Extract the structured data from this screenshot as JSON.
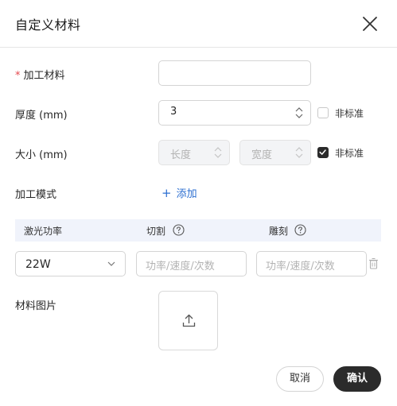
{
  "dialog": {
    "title": "自定义材料",
    "close_icon": "close-icon"
  },
  "form": {
    "material": {
      "required_mark": "*",
      "label": "加工材料",
      "value": ""
    },
    "thickness": {
      "label": "厚度 (mm)",
      "value": "3",
      "nonstandard_label": "非标准",
      "nonstandard_checked": false
    },
    "size": {
      "label": "大小 (mm)",
      "length_placeholder": "长度",
      "width_placeholder": "宽度",
      "nonstandard_label": "非标准",
      "nonstandard_checked": true
    },
    "mode": {
      "label": "加工模式",
      "add_label": "添加"
    }
  },
  "table": {
    "headers": [
      "激光功率",
      "切割",
      "雕刻"
    ],
    "rows": [
      {
        "power": "22W",
        "cut_placeholder": "功率/速度/次数",
        "engrave_placeholder": "功率/速度/次数"
      }
    ]
  },
  "image": {
    "label": "材料图片",
    "upload_icon": "upload-icon"
  },
  "footer": {
    "cancel_label": "取消",
    "confirm_label": "确认"
  },
  "colors": {
    "primary_dark": "#2b2b2b",
    "link_blue": "#2c6fd1",
    "required_red": "#e5484d",
    "table_header_bg": "#f0f3fb"
  }
}
